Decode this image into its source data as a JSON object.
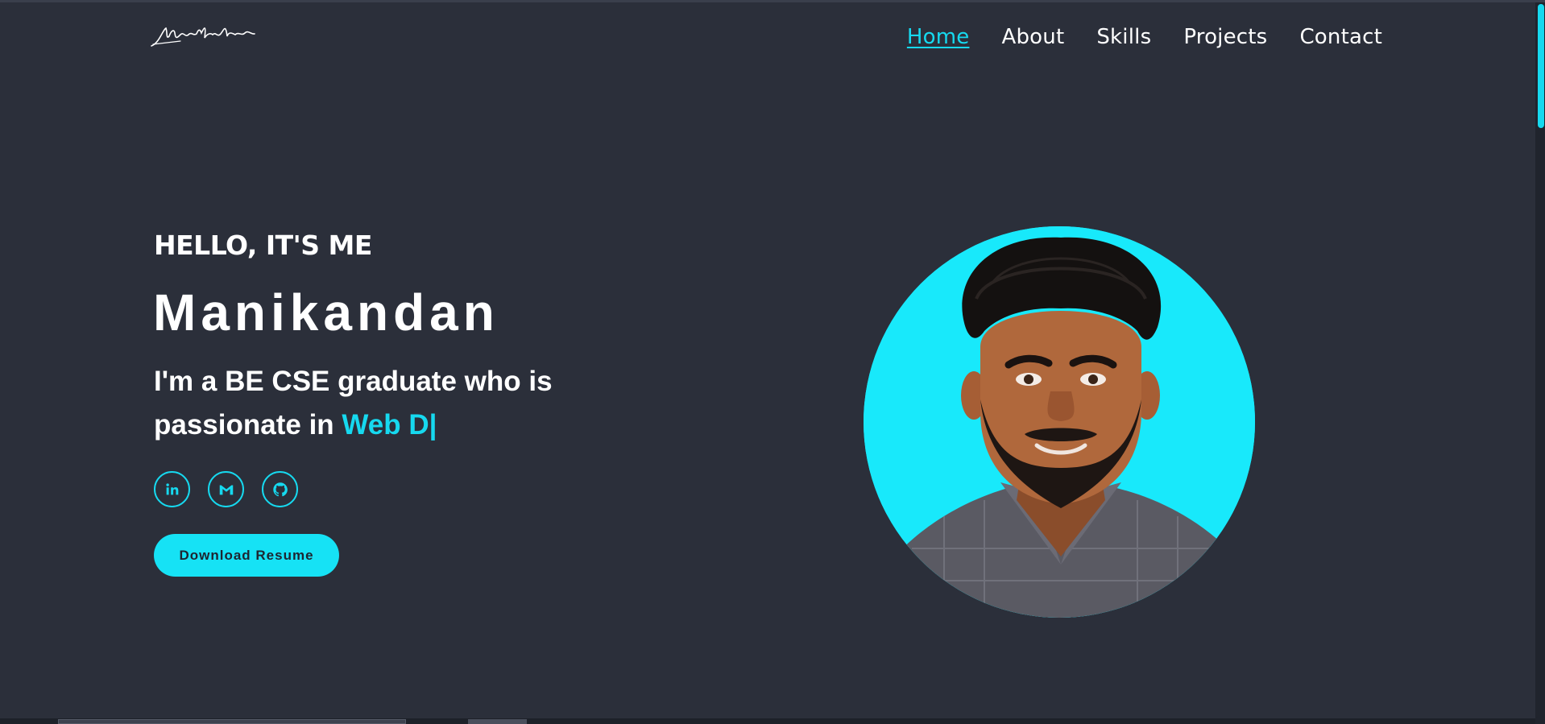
{
  "header": {
    "logo_text": "Manikandan",
    "nav": [
      {
        "label": "Home",
        "active": true
      },
      {
        "label": "About",
        "active": false
      },
      {
        "label": "Skills",
        "active": false
      },
      {
        "label": "Projects",
        "active": false
      },
      {
        "label": "Contact",
        "active": false
      }
    ]
  },
  "hero": {
    "greeting": "HELLO, IT'S ME",
    "name": "Manikandan",
    "tagline_prefix": "I'm a BE CSE graduate who is passionate in ",
    "tagline_typed": "Web D|",
    "socials": [
      {
        "icon": "linkedin-icon"
      },
      {
        "icon": "gmail-icon"
      },
      {
        "icon": "github-icon"
      }
    ],
    "resume_button": "Download Resume"
  },
  "colors": {
    "background": "#2b2f3a",
    "accent": "#16d9ef",
    "text": "#ffffff"
  }
}
